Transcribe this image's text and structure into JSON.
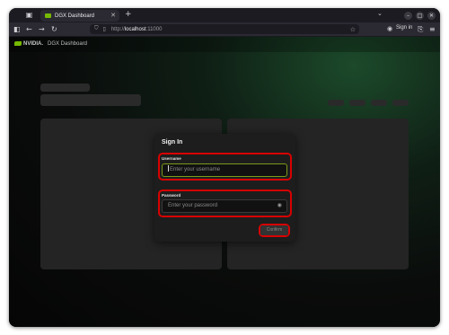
{
  "browser": {
    "tab_title": "DGX Dashboard",
    "url_host": "http://",
    "url_path": "localhost",
    "url_port": ":11000",
    "sign_in_label": "Sign in"
  },
  "app": {
    "brand": "NVIDIA.",
    "title": "DGX Dashboard"
  },
  "signin": {
    "heading": "Sign In",
    "username_label": "Username",
    "username_placeholder": "Enter your username",
    "password_label": "Password",
    "password_placeholder": "Enter your password",
    "confirm_label": "Confirm"
  },
  "colors": {
    "accent": "#76b900",
    "highlight": "#d80000"
  }
}
